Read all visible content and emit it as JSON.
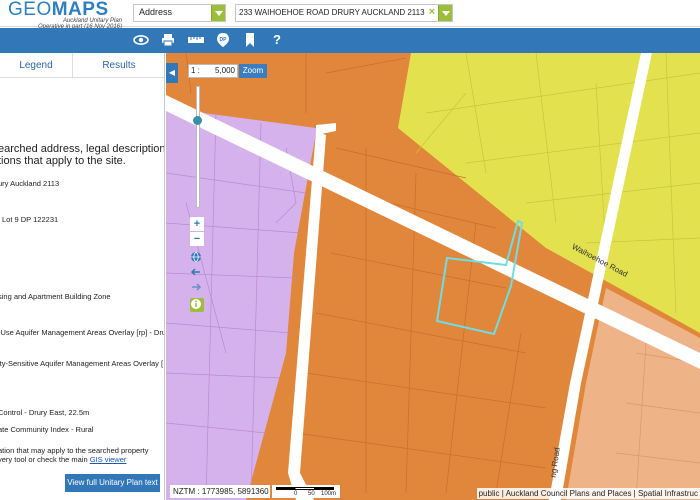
{
  "app": {
    "logo_title_light": "GEO",
    "logo_title_bold": "MAPS",
    "logo_sub_1": "Auckland Unitary Plan",
    "logo_sub_2": "Operative in part (16 Nov 2016)"
  },
  "search": {
    "type_value": "Address",
    "address_value": "233 WAIHOEHOE ROAD DRURY AUCKLAND 2113",
    "clear_icon": "×"
  },
  "toolbar": {
    "icons": [
      "eye-icon",
      "print-icon",
      "measure-icon",
      "dp-icon",
      "bookmark-icon",
      "help-icon"
    ],
    "help_label": "?"
  },
  "panel": {
    "tab_legend": "Legend",
    "tab_results": "Results",
    "intro_line1": "earched address, legal description,",
    "intro_line2": "tions that apply to the site.",
    "address": "ury Auckland 2113",
    "legal": "Lot 9 DP 122231",
    "zone": "sing and Apartment Building Zone",
    "overlay1": "-Use Aquifer Management Areas Overlay [rp] - Dru",
    "overlay2": "ity-Sensitive Aquifer Management Areas Overlay [",
    "control": "Control - Drury East, 22.5m",
    "community": "ate Community Index - Rural",
    "info_line1": "ation that may apply to the searched property",
    "info_line2_pre": "very tool or check the main ",
    "info_link": "GIS viewer",
    "view_button": "View full Unitary Plan text"
  },
  "map": {
    "scale_prefix": "1 :",
    "scale_value": "5,000",
    "zoom_button": "Zoom",
    "zoom_level": 0.72,
    "plus_label": "+",
    "minus_label": "−",
    "coords": "NZTM : 1773985, 5891360",
    "scalebar_labels": [
      "0",
      "50",
      "100m"
    ],
    "attribution": "public | Auckland Council Plans and Places | Spatial Infrastruc",
    "road_label_1": "Waihoehoe Road",
    "road_label_2": "ng Road",
    "colors": {
      "orange": "#e0873b",
      "yellow": "#e3e24e",
      "purple": "#d6b2ec",
      "peach": "#efb388",
      "road": "#ffffff",
      "highlight": "#6fdde6",
      "accent": "#3277b7",
      "green": "#9cbf3b"
    }
  }
}
